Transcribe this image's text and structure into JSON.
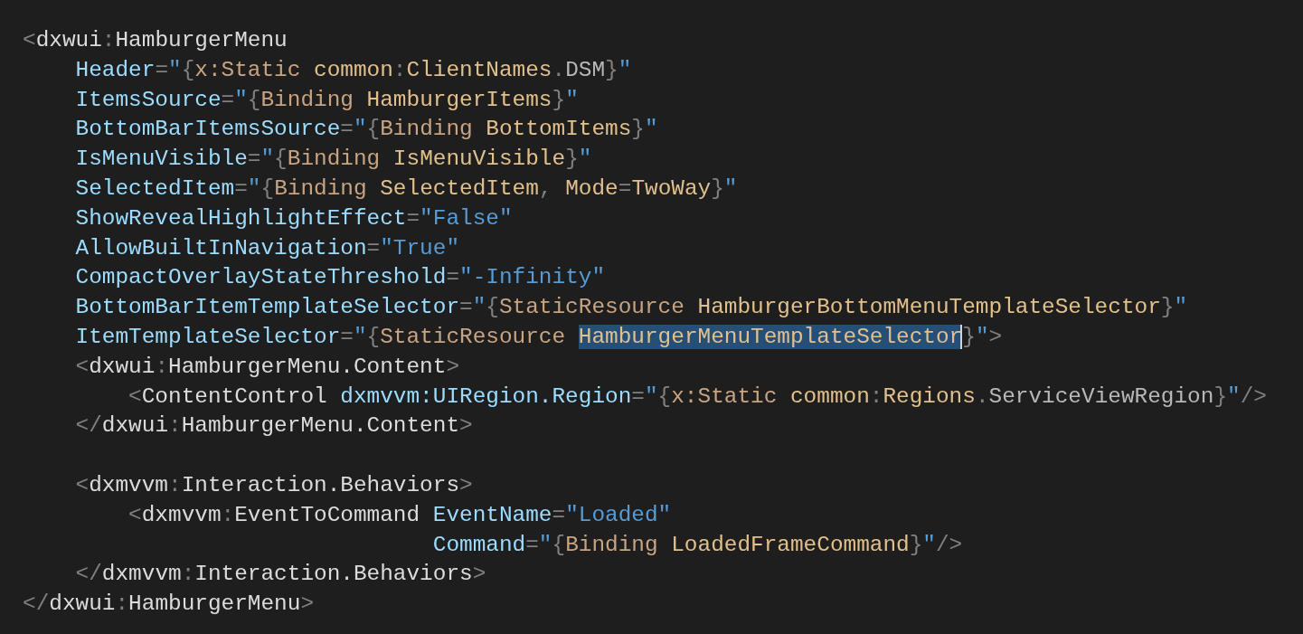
{
  "editor": {
    "lines": [
      {
        "kind": "code",
        "tokens": [
          {
            "text": "<",
            "kind": "punct"
          },
          {
            "text": "dxwui",
            "kind": "tag"
          },
          {
            "text": ":",
            "kind": "punct"
          },
          {
            "text": "HamburgerMenu",
            "kind": "tag"
          }
        ]
      },
      {
        "kind": "code",
        "tokens": [
          {
            "text": "    Header",
            "kind": "attr"
          },
          {
            "text": "=",
            "kind": "punct"
          },
          {
            "text": "\"",
            "kind": "quote"
          },
          {
            "text": "{",
            "kind": "punct"
          },
          {
            "text": "x:Static ",
            "kind": "ext"
          },
          {
            "text": "common",
            "kind": "ref"
          },
          {
            "text": ":",
            "kind": "punct"
          },
          {
            "text": "ClientNames",
            "kind": "ref"
          },
          {
            "text": ".",
            "kind": "punct"
          },
          {
            "text": "DSM",
            "kind": "member"
          },
          {
            "text": "}",
            "kind": "punct"
          },
          {
            "text": "\"",
            "kind": "quote"
          }
        ]
      },
      {
        "kind": "code",
        "tokens": [
          {
            "text": "    ItemsSource",
            "kind": "attr"
          },
          {
            "text": "=",
            "kind": "punct"
          },
          {
            "text": "\"",
            "kind": "quote"
          },
          {
            "text": "{",
            "kind": "punct"
          },
          {
            "text": "Binding ",
            "kind": "ext"
          },
          {
            "text": "HamburgerItems",
            "kind": "ref"
          },
          {
            "text": "}",
            "kind": "punct"
          },
          {
            "text": "\"",
            "kind": "quote"
          }
        ]
      },
      {
        "kind": "code",
        "tokens": [
          {
            "text": "    BottomBarItemsSource",
            "kind": "attr"
          },
          {
            "text": "=",
            "kind": "punct"
          },
          {
            "text": "\"",
            "kind": "quote"
          },
          {
            "text": "{",
            "kind": "punct"
          },
          {
            "text": "Binding ",
            "kind": "ext"
          },
          {
            "text": "BottomItems",
            "kind": "ref"
          },
          {
            "text": "}",
            "kind": "punct"
          },
          {
            "text": "\"",
            "kind": "quote"
          }
        ]
      },
      {
        "kind": "code",
        "tokens": [
          {
            "text": "    IsMenuVisible",
            "kind": "attr"
          },
          {
            "text": "=",
            "kind": "punct"
          },
          {
            "text": "\"",
            "kind": "quote"
          },
          {
            "text": "{",
            "kind": "punct"
          },
          {
            "text": "Binding ",
            "kind": "ext"
          },
          {
            "text": "IsMenuVisible",
            "kind": "ref"
          },
          {
            "text": "}",
            "kind": "punct"
          },
          {
            "text": "\"",
            "kind": "quote"
          }
        ]
      },
      {
        "kind": "code",
        "tokens": [
          {
            "text": "    SelectedItem",
            "kind": "attr"
          },
          {
            "text": "=",
            "kind": "punct"
          },
          {
            "text": "\"",
            "kind": "quote"
          },
          {
            "text": "{",
            "kind": "punct"
          },
          {
            "text": "Binding ",
            "kind": "ext"
          },
          {
            "text": "SelectedItem",
            "kind": "ref"
          },
          {
            "text": ", ",
            "kind": "punct"
          },
          {
            "text": "Mode",
            "kind": "ref"
          },
          {
            "text": "=",
            "kind": "punct"
          },
          {
            "text": "TwoWay",
            "kind": "ref"
          },
          {
            "text": "}",
            "kind": "punct"
          },
          {
            "text": "\"",
            "kind": "quote"
          }
        ]
      },
      {
        "kind": "code",
        "tokens": [
          {
            "text": "    ShowRevealHighlightEffect",
            "kind": "attr"
          },
          {
            "text": "=",
            "kind": "punct"
          },
          {
            "text": "\"False\"",
            "kind": "string"
          }
        ]
      },
      {
        "kind": "code",
        "tokens": [
          {
            "text": "    AllowBuiltInNavigation",
            "kind": "attr"
          },
          {
            "text": "=",
            "kind": "punct"
          },
          {
            "text": "\"True\"",
            "kind": "string"
          }
        ]
      },
      {
        "kind": "code",
        "tokens": [
          {
            "text": "    CompactOverlayStateThreshold",
            "kind": "attr"
          },
          {
            "text": "=",
            "kind": "punct"
          },
          {
            "text": "\"-Infinity\"",
            "kind": "string"
          }
        ]
      },
      {
        "kind": "code",
        "tokens": [
          {
            "text": "    BottomBarItemTemplateSelector",
            "kind": "attr"
          },
          {
            "text": "=",
            "kind": "punct"
          },
          {
            "text": "\"",
            "kind": "quote"
          },
          {
            "text": "{",
            "kind": "punct"
          },
          {
            "text": "StaticResource ",
            "kind": "ext"
          },
          {
            "text": "HamburgerBottomMenuTemplateSelector",
            "kind": "ref"
          },
          {
            "text": "}",
            "kind": "punct"
          },
          {
            "text": "\"",
            "kind": "quote"
          }
        ]
      },
      {
        "kind": "code",
        "tokens": [
          {
            "text": "    ItemTemplateSelector",
            "kind": "attr"
          },
          {
            "text": "=",
            "kind": "punct"
          },
          {
            "text": "\"",
            "kind": "quote"
          },
          {
            "text": "{",
            "kind": "punct"
          },
          {
            "text": "StaticResource ",
            "kind": "ext"
          },
          {
            "text": "HamburgerMenuTemplateSelector",
            "kind": "selection"
          },
          {
            "text": "}",
            "kind": "punct"
          },
          {
            "text": "\"",
            "kind": "quote"
          },
          {
            "text": ">",
            "kind": "punct"
          }
        ]
      },
      {
        "kind": "code",
        "tokens": [
          {
            "text": "    <",
            "kind": "punct"
          },
          {
            "text": "dxwui",
            "kind": "tag"
          },
          {
            "text": ":",
            "kind": "punct"
          },
          {
            "text": "HamburgerMenu.Content",
            "kind": "tag"
          },
          {
            "text": ">",
            "kind": "punct"
          }
        ]
      },
      {
        "kind": "code",
        "tokens": [
          {
            "text": "        <",
            "kind": "punct"
          },
          {
            "text": "ContentControl ",
            "kind": "tag"
          },
          {
            "text": "dxmvvm:UIRegion.Region",
            "kind": "attr"
          },
          {
            "text": "=",
            "kind": "punct"
          },
          {
            "text": "\"",
            "kind": "quote"
          },
          {
            "text": "{",
            "kind": "punct"
          },
          {
            "text": "x:Static ",
            "kind": "ext"
          },
          {
            "text": "common",
            "kind": "ref"
          },
          {
            "text": ":",
            "kind": "punct"
          },
          {
            "text": "Regions",
            "kind": "ref"
          },
          {
            "text": ".",
            "kind": "punct"
          },
          {
            "text": "ServiceViewRegion",
            "kind": "member"
          },
          {
            "text": "}",
            "kind": "punct"
          },
          {
            "text": "\"",
            "kind": "quote"
          },
          {
            "text": "/>",
            "kind": "punct"
          }
        ]
      },
      {
        "kind": "code",
        "tokens": [
          {
            "text": "    </",
            "kind": "punct"
          },
          {
            "text": "dxwui",
            "kind": "tag"
          },
          {
            "text": ":",
            "kind": "punct"
          },
          {
            "text": "HamburgerMenu.Content",
            "kind": "tag"
          },
          {
            "text": ">",
            "kind": "punct"
          }
        ]
      },
      {
        "kind": "blank"
      },
      {
        "kind": "code",
        "tokens": [
          {
            "text": "    <",
            "kind": "punct"
          },
          {
            "text": "dxmvvm",
            "kind": "tag"
          },
          {
            "text": ":",
            "kind": "punct"
          },
          {
            "text": "Interaction.Behaviors",
            "kind": "tag"
          },
          {
            "text": ">",
            "kind": "punct"
          }
        ]
      },
      {
        "kind": "code",
        "tokens": [
          {
            "text": "        <",
            "kind": "punct"
          },
          {
            "text": "dxmvvm",
            "kind": "tag"
          },
          {
            "text": ":",
            "kind": "punct"
          },
          {
            "text": "EventToCommand ",
            "kind": "tag"
          },
          {
            "text": "EventName",
            "kind": "attr"
          },
          {
            "text": "=",
            "kind": "punct"
          },
          {
            "text": "\"Loaded\"",
            "kind": "string"
          }
        ]
      },
      {
        "kind": "code",
        "tokens": [
          {
            "text": "                               Command",
            "kind": "attr"
          },
          {
            "text": "=",
            "kind": "punct"
          },
          {
            "text": "\"",
            "kind": "quote"
          },
          {
            "text": "{",
            "kind": "punct"
          },
          {
            "text": "Binding ",
            "kind": "ext"
          },
          {
            "text": "LoadedFrameCommand",
            "kind": "ref"
          },
          {
            "text": "}",
            "kind": "punct"
          },
          {
            "text": "\"",
            "kind": "quote"
          },
          {
            "text": "/>",
            "kind": "punct"
          }
        ]
      },
      {
        "kind": "code",
        "tokens": [
          {
            "text": "    </",
            "kind": "punct"
          },
          {
            "text": "dxmvvm",
            "kind": "tag"
          },
          {
            "text": ":",
            "kind": "punct"
          },
          {
            "text": "Interaction.Behaviors",
            "kind": "tag"
          },
          {
            "text": ">",
            "kind": "punct"
          }
        ]
      },
      {
        "kind": "code",
        "tokens": [
          {
            "text": "</",
            "kind": "punct"
          },
          {
            "text": "dxwui",
            "kind": "tag"
          },
          {
            "text": ":",
            "kind": "punct"
          },
          {
            "text": "HamburgerMenu",
            "kind": "tag"
          },
          {
            "text": ">",
            "kind": "punct"
          }
        ]
      }
    ]
  }
}
